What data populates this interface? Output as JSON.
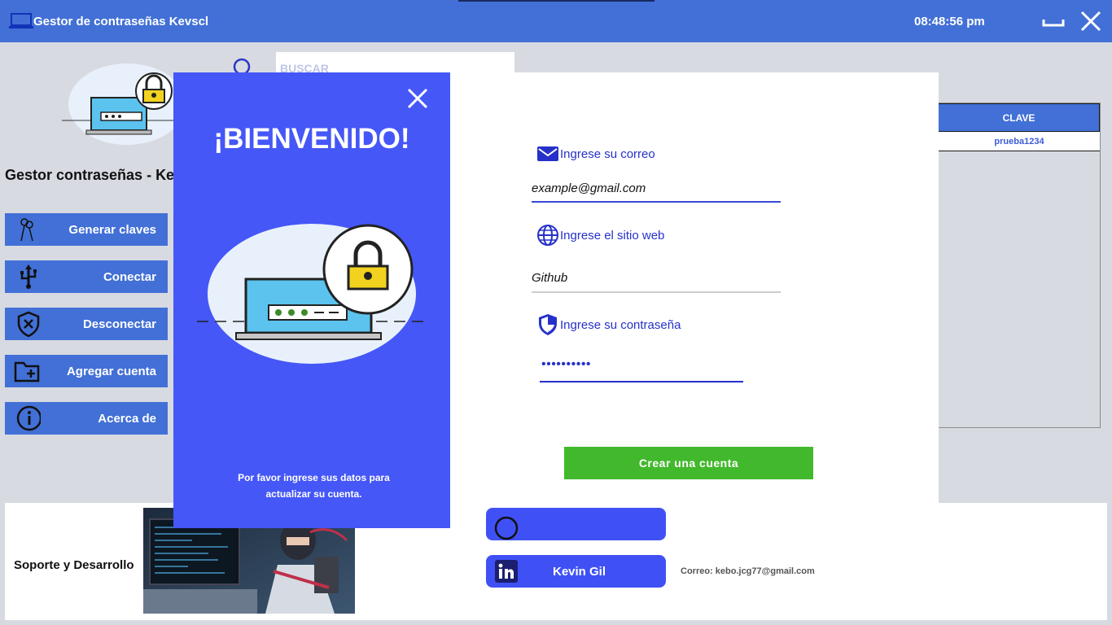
{
  "window": {
    "title": "Gestor de contraseñas Kevscl",
    "clock": "08:48:56 pm"
  },
  "sidebar": {
    "title": "Gestor contraseñas - Kevscl",
    "buttons": [
      {
        "label": "Generar claves",
        "icon": "keys-icon"
      },
      {
        "label": "Conectar",
        "icon": "usb-icon"
      },
      {
        "label": "Desconectar",
        "icon": "shield-x-icon"
      },
      {
        "label": "Agregar cuenta",
        "icon": "folder-plus-icon"
      },
      {
        "label": "Acerca de",
        "icon": "info-icon"
      }
    ]
  },
  "search": {
    "placeholder": "BUSCAR"
  },
  "table": {
    "header": "CLAVE",
    "rows": [
      "prueba1234"
    ]
  },
  "footer": {
    "support_label": "Soporte y Desarrollo",
    "linkedin_name": "Kevin Gil",
    "email_text": "Correo: kebo.jcg77@gmail.com"
  },
  "modal": {
    "welcome": "¡BIENVENIDO!",
    "note_line1": "Por favor ingrese sus datos para",
    "note_line2": "actualizar su cuenta.",
    "email_label": "Ingrese su correo",
    "email_value": "example@gmail.com",
    "site_label": "Ingrese el sitio web",
    "site_value": "Github",
    "password_label": "Ingrese su contraseña",
    "password_value": "••••••••••",
    "submit_label": "Crear una cuenta"
  },
  "colors": {
    "titlebar": "#4270d6",
    "modal_panel": "#4557f7",
    "submit": "#42b82d",
    "accent_text": "#2631c9"
  }
}
